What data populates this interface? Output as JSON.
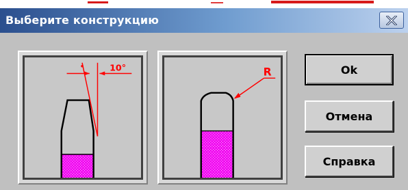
{
  "dialog": {
    "title": "Выберите конструкцию",
    "close_glyph": "X"
  },
  "options": [
    {
      "name": "conical-construction",
      "annotation": "10°",
      "fill_color": "#f000f0"
    },
    {
      "name": "rounded-construction",
      "annotation": "R",
      "fill_color": "#f000f0"
    }
  ],
  "buttons": {
    "ok": "Ok",
    "cancel": "Отмена",
    "help": "Справка"
  },
  "colors": {
    "title_gradient_start": "#2b4f8e",
    "title_gradient_end": "#bcd1ee",
    "annotation_red": "#ff0000",
    "window_bg": "#c0c0c0"
  }
}
